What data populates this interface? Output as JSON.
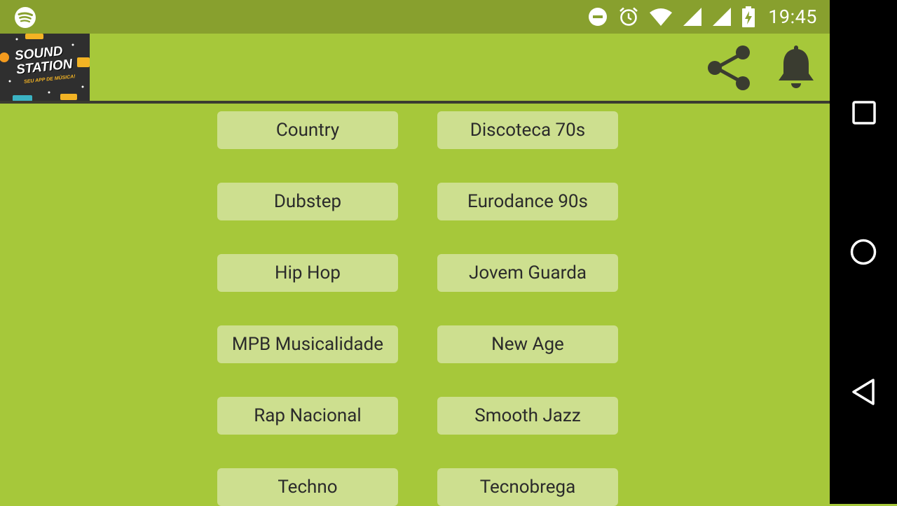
{
  "status_bar": {
    "time": "19:45",
    "left_icons": [
      "spotify-icon"
    ],
    "right_icons": [
      "do-not-disturb-icon",
      "alarm-icon",
      "wifi-icon",
      "signal-icon",
      "signal-icon",
      "battery-charging-icon"
    ]
  },
  "app_bar": {
    "logo": {
      "line1": "SOUND",
      "line2": "STATION",
      "tagline": "SEU APP DE MÚSICA!"
    },
    "actions": [
      "share-icon",
      "notification-bell-icon"
    ]
  },
  "genres": [
    [
      "Country",
      "Discoteca 70s"
    ],
    [
      "Dubstep",
      "Eurodance 90s"
    ],
    [
      "Hip Hop",
      "Jovem Guarda"
    ],
    [
      "MPB Musicalidade",
      "New Age"
    ],
    [
      "Rap Nacional",
      "Smooth Jazz"
    ],
    [
      "Techno",
      "Tecnobrega"
    ]
  ],
  "nav_bar": {
    "buttons": [
      "recents-icon",
      "home-icon",
      "back-icon"
    ]
  },
  "colors": {
    "background": "#a6c83a",
    "status_bar": "#88a02e",
    "button": "#cddf8f",
    "divider": "#3a3c30",
    "icon": "#3a3c30"
  }
}
